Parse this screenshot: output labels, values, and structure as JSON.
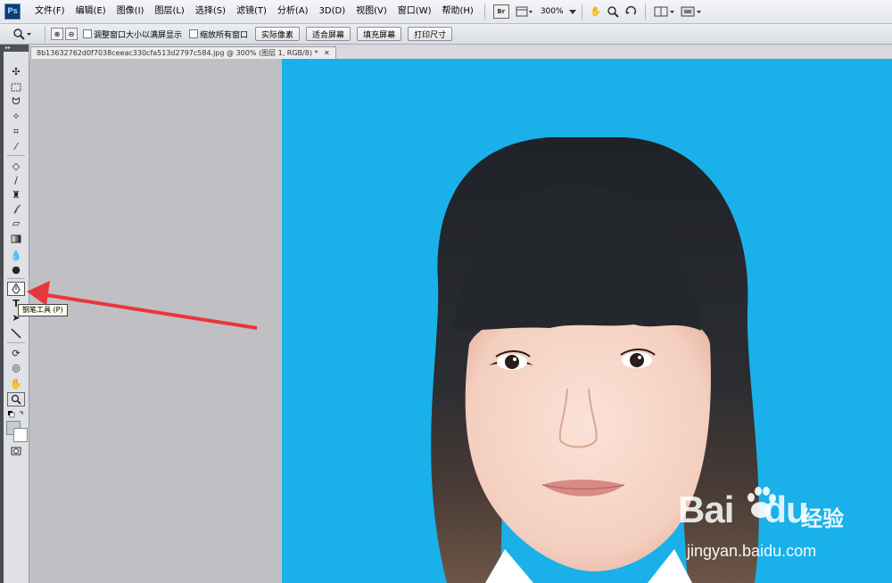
{
  "app": {
    "logo": "Ps"
  },
  "menu": [
    "文件(F)",
    "编辑(E)",
    "图像(I)",
    "图层(L)",
    "选择(S)",
    "滤镜(T)",
    "分析(A)",
    "3D(D)",
    "视图(V)",
    "窗口(W)",
    "帮助(H)"
  ],
  "appbar": {
    "bridge_label": "Br",
    "zoom_level": "300%"
  },
  "options": {
    "checkbox_resize": "调整窗口大小以满屏显示",
    "checkbox_zoom_all": "缩放所有窗口",
    "btn_actual": "实际像素",
    "btn_fit": "适合屏幕",
    "btn_fill": "填充屏幕",
    "btn_print": "打印尺寸"
  },
  "document": {
    "tab_title": "8b13632762d0f7038ceeac330cfa513d2797c584.jpg @ 300% (图层 1, RGB/8) *"
  },
  "tooltip": {
    "text": "钢笔工具 (P)"
  },
  "watermark": {
    "brand": "Bai",
    "brand2": "du",
    "cn": "经验",
    "url": "jingyan.baidu.com"
  },
  "colors": {
    "photo_bg": "#1ab1ea",
    "arrow": "#e8373b",
    "workspace": "#c0bfc4"
  }
}
